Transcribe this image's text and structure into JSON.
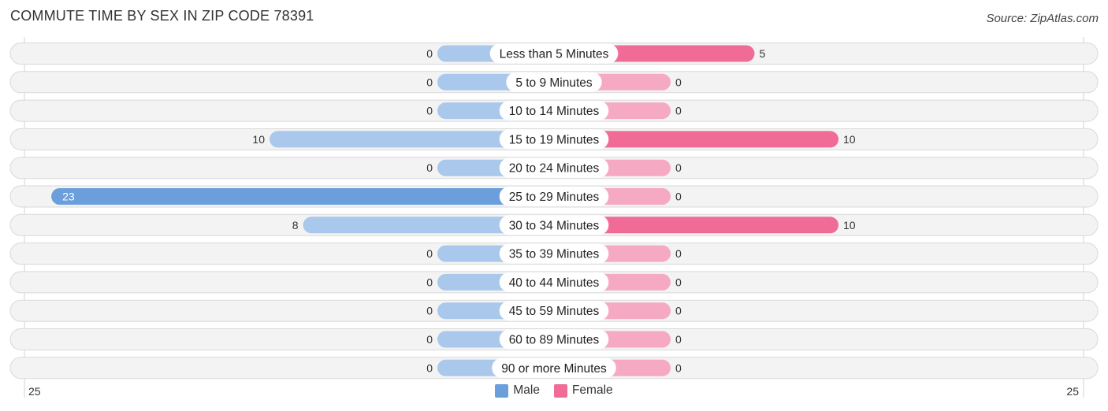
{
  "title": "COMMUTE TIME BY SEX IN ZIP CODE 78391",
  "source": "Source: ZipAtlas.com",
  "colors": {
    "male_strong": "#6a9fdb",
    "male_light": "#a9c8eb",
    "female_strong": "#f06b95",
    "female_light": "#f5a9c2"
  },
  "chart_data": {
    "type": "bar",
    "orientation": "horizontal-diverging",
    "title": "COMMUTE TIME BY SEX IN ZIP CODE 78391",
    "categories": [
      "Less than 5 Minutes",
      "5 to 9 Minutes",
      "10 to 14 Minutes",
      "15 to 19 Minutes",
      "20 to 24 Minutes",
      "25 to 29 Minutes",
      "30 to 34 Minutes",
      "35 to 39 Minutes",
      "40 to 44 Minutes",
      "45 to 59 Minutes",
      "60 to 89 Minutes",
      "90 or more Minutes"
    ],
    "series": [
      {
        "name": "Male",
        "values": [
          0,
          0,
          0,
          10,
          0,
          23,
          8,
          0,
          0,
          0,
          0,
          0
        ]
      },
      {
        "name": "Female",
        "values": [
          5,
          0,
          0,
          10,
          0,
          0,
          10,
          0,
          0,
          0,
          0,
          0
        ]
      }
    ],
    "axis": {
      "left_label": "25",
      "right_label": "25",
      "max": 25
    },
    "legend": {
      "position": "bottom-center",
      "entries": [
        "Male",
        "Female"
      ]
    },
    "grid": false
  }
}
